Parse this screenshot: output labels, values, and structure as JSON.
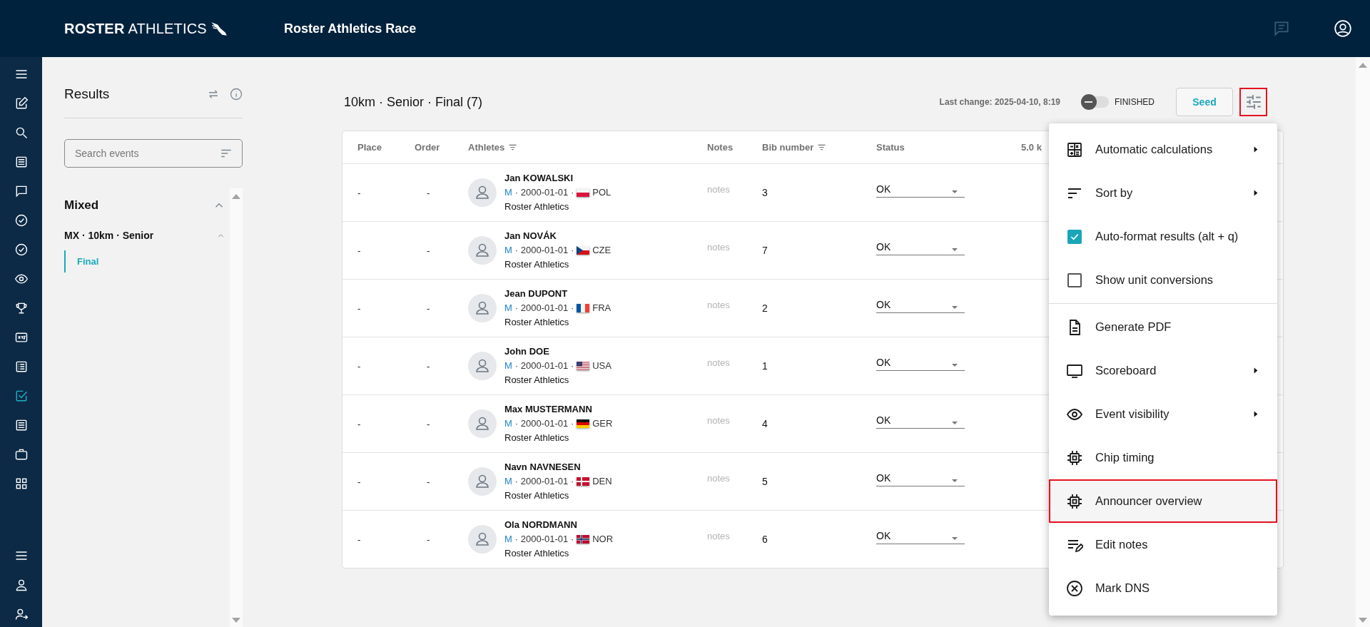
{
  "header": {
    "brand_bold": "ROSTER",
    "brand_light": "ATHLETICS",
    "title": "Roster Athletics Race"
  },
  "nav": {
    "items": [
      {
        "selected": false
      },
      {
        "selected": false
      },
      {
        "selected": false
      },
      {
        "selected": false
      },
      {
        "selected": false
      },
      {
        "selected": false
      },
      {
        "selected": false
      },
      {
        "selected": false
      },
      {
        "selected": false
      },
      {
        "selected": false
      },
      {
        "selected": false
      },
      {
        "selected": true
      },
      {
        "selected": false
      },
      {
        "selected": false
      },
      {
        "selected": false
      }
    ],
    "bottom_items": [
      {
        "selected": false
      },
      {
        "selected": false
      },
      {
        "selected": false
      }
    ]
  },
  "results_panel": {
    "title": "Results",
    "search": {
      "placeholder": "Search events"
    },
    "groups": [
      {
        "name": "Mixed",
        "expanded": true,
        "events": [
          {
            "name": "MX · 10km · Senior",
            "expanded": true,
            "rounds": [
              {
                "name": "Final",
                "selected": true
              }
            ]
          }
        ]
      }
    ]
  },
  "main": {
    "title": "10km · Senior · Final (7)",
    "last_change": "Last change: 2025-04-10, 8:19",
    "finished_toggle": {
      "label": "FINISHED",
      "on": false
    },
    "seed_button": "Seed",
    "settings_button": {
      "highlighted": true
    },
    "table": {
      "columns": [
        {
          "label": "Place",
          "filter": false
        },
        {
          "label": "Order",
          "filter": false
        },
        {
          "label": "Athletes",
          "filter": true
        },
        {
          "label": "Notes",
          "filter": false
        },
        {
          "label": "Bib number",
          "filter": true
        },
        {
          "label": "Status",
          "filter": false
        },
        {
          "label": "5.0 k",
          "filter": false
        }
      ],
      "rows": [
        {
          "place": "-",
          "order": "-",
          "name": "Jan KOWALSKI",
          "gender": "M",
          "birth_date": "· 2000-01-01 ·",
          "country": "POL",
          "club": "Roster Athletics",
          "notes": "notes",
          "bib": "3",
          "status": "OK"
        },
        {
          "place": "-",
          "order": "-",
          "name": "Jan NOVÁK",
          "gender": "M",
          "birth_date": "· 2000-01-01 ·",
          "country": "CZE",
          "club": "Roster Athletics",
          "notes": "notes",
          "bib": "7",
          "status": "OK"
        },
        {
          "place": "-",
          "order": "-",
          "name": "Jean DUPONT",
          "gender": "M",
          "birth_date": "· 2000-01-01 ·",
          "country": "FRA",
          "club": "Roster Athletics",
          "notes": "notes",
          "bib": "2",
          "status": "OK"
        },
        {
          "place": "-",
          "order": "-",
          "name": "John DOE",
          "gender": "M",
          "birth_date": "· 2000-01-01 ·",
          "country": "USA",
          "club": "Roster Athletics",
          "notes": "notes",
          "bib": "1",
          "status": "OK"
        },
        {
          "place": "-",
          "order": "-",
          "name": "Max MUSTERMANN",
          "gender": "M",
          "birth_date": "· 2000-01-01 ·",
          "country": "GER",
          "club": "Roster Athletics",
          "notes": "notes",
          "bib": "4",
          "status": "OK"
        },
        {
          "place": "-",
          "order": "-",
          "name": "Navn NAVNESEN",
          "gender": "M",
          "birth_date": "· 2000-01-01 ·",
          "country": "DEN",
          "club": "Roster Athletics",
          "notes": "notes",
          "bib": "5",
          "status": "OK"
        },
        {
          "place": "-",
          "order": "-",
          "name": "Ola NORDMANN",
          "gender": "M",
          "birth_date": "· 2000-01-01 ·",
          "country": "NOR",
          "club": "Roster Athletics",
          "notes": "notes",
          "bib": "6",
          "status": "OK"
        }
      ]
    },
    "menu": {
      "sections": [
        [
          {
            "kind": "submenu",
            "label": "Automatic calculations",
            "highlighted": false
          },
          {
            "kind": "submenu",
            "label": "Sort by",
            "highlighted": false
          },
          {
            "kind": "checkbox",
            "label": "Auto-format results (alt + q)",
            "checked": true,
            "highlighted": false
          },
          {
            "kind": "checkbox",
            "label": "Show unit conversions",
            "checked": false,
            "highlighted": false
          }
        ],
        [
          {
            "kind": "action",
            "label": "Generate PDF",
            "highlighted": false
          },
          {
            "kind": "submenu",
            "label": "Scoreboard",
            "highlighted": false
          },
          {
            "kind": "submenu",
            "label": "Event visibility",
            "highlighted": false
          },
          {
            "kind": "action",
            "label": "Chip timing",
            "highlighted": false
          },
          {
            "kind": "action",
            "label": "Announcer overview",
            "highlighted": true
          },
          {
            "kind": "action",
            "label": "Edit notes",
            "highlighted": false
          },
          {
            "kind": "action",
            "label": "Mark DNS",
            "highlighted": false
          }
        ]
      ]
    }
  }
}
